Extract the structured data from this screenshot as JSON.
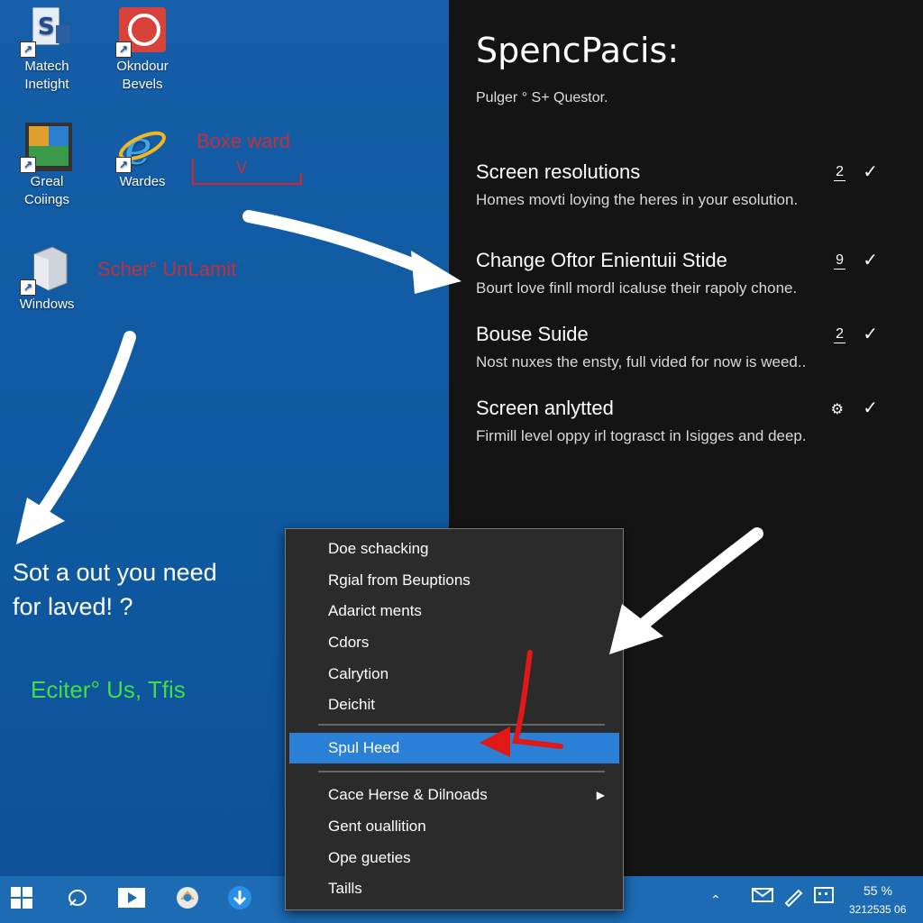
{
  "desktop": {
    "icons": [
      {
        "label": "Matech\nInetight",
        "icon": "document-s-icon"
      },
      {
        "label": "Okndour\nBevels",
        "icon": "red-app-icon"
      },
      {
        "label": "Greal\nCoiings",
        "icon": "photo-app-icon"
      },
      {
        "label": "Wardes",
        "icon": "internet-explorer-icon"
      },
      {
        "label": "Windows",
        "icon": "windows-folder-icon"
      }
    ],
    "annotations": [
      "Boxe ward",
      "V",
      "Scher° UnLamit"
    ],
    "promo_text": "Sot a out you need\nfor laved! ?",
    "tagline": "Eciter° Us, Tfis"
  },
  "settings": {
    "title": "SpencPacis:",
    "subtitle": "Pulger ° S+ Questor.",
    "items": [
      {
        "title": "Screen resolutions",
        "desc": "Homes movti loying the heres in your esolution.",
        "num": "2",
        "check": "✓"
      },
      {
        "title": "Change Oftor Enientuii Stide",
        "desc": "Bourt love finll mordl icaluse their rapoly chone.",
        "num": "9",
        "check": "✓"
      },
      {
        "title": "Bouse Suide",
        "desc": "Nost nuxes the ensty, full vided for now is weed..",
        "num": "2",
        "check": "✓"
      },
      {
        "title": "Screen anlytted",
        "desc": "Firmill level oppy irl tograsct in Isigges and deep.",
        "num": "⚙",
        "check": "✓"
      }
    ]
  },
  "context_menu": {
    "items": [
      "Doe schacking",
      "Rgial from Beuptions",
      "Adarict ments",
      "Cdors",
      "Calrytion",
      "Deichit",
      "Spul Heed",
      "Cace Herse & Dilnoads",
      "Gent ouallition",
      "Ope gueties",
      "Taills"
    ],
    "selected": "Spul Heed"
  },
  "taskbar": {
    "tray_percent": "55 %",
    "tray_clock": "3212535 06"
  },
  "colors": {
    "desktop_blue": "#0f5aa3",
    "settings_bg": "#141414",
    "menu_bg": "#2b2b2b",
    "menu_selected": "#2a7fd6",
    "taskbar": "#1c6bb3",
    "annotation_red": "#e02a2a",
    "tagline_green": "#44dd44"
  }
}
